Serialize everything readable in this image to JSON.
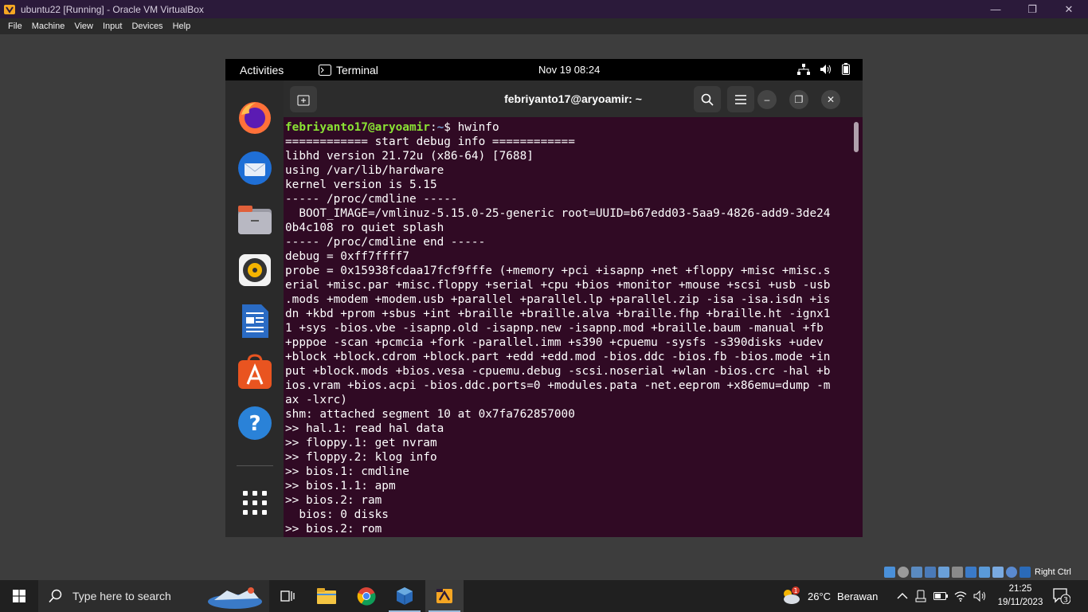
{
  "host_window": {
    "title": "ubuntu22 [Running] - Oracle VM VirtualBox",
    "menu": [
      "File",
      "Machine",
      "View",
      "Input",
      "Devices",
      "Help"
    ]
  },
  "gnome_topbar": {
    "activities": "Activities",
    "app_name": "Terminal",
    "clock": "Nov 19  08:24"
  },
  "dock": {
    "apps": [
      "firefox-icon",
      "thunderbird-icon",
      "files-icon",
      "rhythmbox-icon",
      "libreoffice-writer-icon",
      "ubuntu-software-icon",
      "help-icon",
      "show-apps-icon"
    ]
  },
  "terminal": {
    "title": "febriyanto17@aryoamir: ~",
    "prompt_user": "febriyanto17@aryoamir",
    "prompt_sep": ":",
    "prompt_path": "~",
    "prompt_symbol": "$ ",
    "command": "hwinfo",
    "lines": [
      "============ start debug info ============",
      "libhd version 21.72u (x86-64) [7688]",
      "using /var/lib/hardware",
      "kernel version is 5.15",
      "----- /proc/cmdline -----",
      "  BOOT_IMAGE=/vmlinuz-5.15.0-25-generic root=UUID=b67edd03-5aa9-4826-add9-3de24",
      "0b4c108 ro quiet splash",
      "----- /proc/cmdline end -----",
      "debug = 0xff7ffff7",
      "probe = 0x15938fcdaa17fcf9fffe (+memory +pci +isapnp +net +floppy +misc +misc.s",
      "erial +misc.par +misc.floppy +serial +cpu +bios +monitor +mouse +scsi +usb -usb",
      ".mods +modem +modem.usb +parallel +parallel.lp +parallel.zip -isa -isa.isdn +is",
      "dn +kbd +prom +sbus +int +braille +braille.alva +braille.fhp +braille.ht -ignx1",
      "1 +sys -bios.vbe -isapnp.old -isapnp.new -isapnp.mod +braille.baum -manual +fb",
      "+pppoe -scan +pcmcia +fork -parallel.imm +s390 +cpuemu -sysfs -s390disks +udev",
      "+block +block.cdrom +block.part +edd +edd.mod -bios.ddc -bios.fb -bios.mode +in",
      "put +block.mods +bios.vesa -cpuemu.debug -scsi.noserial +wlan -bios.crc -hal +b",
      "ios.vram +bios.acpi -bios.ddc.ports=0 +modules.pata -net.eeprom +x86emu=dump -m",
      "ax -lxrc)",
      "shm: attached segment 10 at 0x7fa762857000",
      ">> hal.1: read hal data",
      ">> floppy.1: get nvram",
      ">> floppy.2: klog info",
      ">> bios.1: cmdline",
      ">> bios.1.1: apm",
      ">> bios.2: ram",
      "  bios: 0 disks",
      ">> bios.2: rom"
    ]
  },
  "vbox_status": {
    "host_key": "Right Ctrl"
  },
  "taskbar": {
    "search_placeholder": "Type here to search",
    "weather_temp": "26°C",
    "weather_desc": "Berawan",
    "weather_badge": "1",
    "time": "21:25",
    "date": "19/11/2023",
    "notification_count": "3",
    "colors": {
      "bg": "#202020",
      "active_underline": "#9ab8d8"
    }
  }
}
